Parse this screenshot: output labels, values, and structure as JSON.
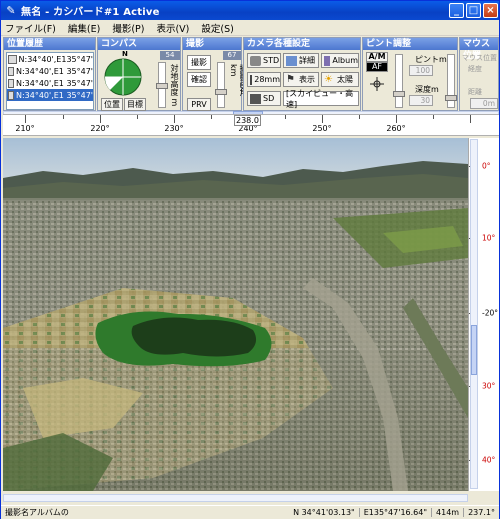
{
  "window": {
    "title": "無名 - カシバード#1 Active"
  },
  "title_buttons": [
    "_",
    "□",
    "×"
  ],
  "menu": [
    {
      "label": "ファイル(F)"
    },
    {
      "label": "編集(E)"
    },
    {
      "label": "撮影(P)"
    },
    {
      "label": "表示(V)"
    },
    {
      "label": "設定(S)"
    }
  ],
  "panels": {
    "location": {
      "title": "位置履歴",
      "items": [
        {
          "label": "N:34°40',E135°47'"
        },
        {
          "label": "N:34°40',E1 35°47'"
        },
        {
          "label": "N:34°40',E1 35°47'"
        },
        {
          "label": "N:34°40',E1 35°47'"
        }
      ]
    },
    "compass": {
      "title": "コンパス",
      "north": "N",
      "value": "54",
      "side_label": "対地高度 m",
      "btn_position": "位置",
      "btn_target": "目標"
    },
    "shoot": {
      "title": "撮影",
      "value": "67",
      "btn_shoot": "撮影",
      "btn_confirm": "確認",
      "btn_prv": "PRV",
      "side_label": "撮影画角 km"
    },
    "camera": {
      "title": "カメラ各種設定",
      "btn_std": "STD",
      "btn_detail": "詳細",
      "btn_album": "Album",
      "btn_28mm": "28mm",
      "btn_display": "表示",
      "btn_sun": "太陽",
      "btn_sd": "SD",
      "mode": "[スカイビュー・高速]"
    },
    "focus": {
      "title": "ピント調整",
      "btn_am": "A/M",
      "btn_af": "AF",
      "focus_label": "ピントm",
      "focus_value": "100",
      "depth_label": "深度m",
      "depth_value": "30"
    },
    "mouse": {
      "title": "マウス位置",
      "line1": "マウス位置",
      "line2": "経度",
      "line3": "距離",
      "value": "0m"
    }
  },
  "ruler": {
    "current": "238.0",
    "labels": [
      "210°",
      "220°",
      "230°",
      "240°",
      "250°",
      "260°"
    ]
  },
  "vruler": {
    "labels": [
      "0°",
      "10°",
      "-20°",
      "30°",
      "40°"
    ]
  },
  "status": {
    "left": "撮影名アルバムの",
    "lat": "N 34°41'03.13\"",
    "lon": "E135°47'16.64\"",
    "alt": "414m",
    "heading": "237.1°"
  },
  "colors": {
    "titlebar": "#0a5ce8",
    "panel_header": "#4d77cf",
    "sky": "#9fb8cf",
    "vruler_label": "#cc0000"
  }
}
